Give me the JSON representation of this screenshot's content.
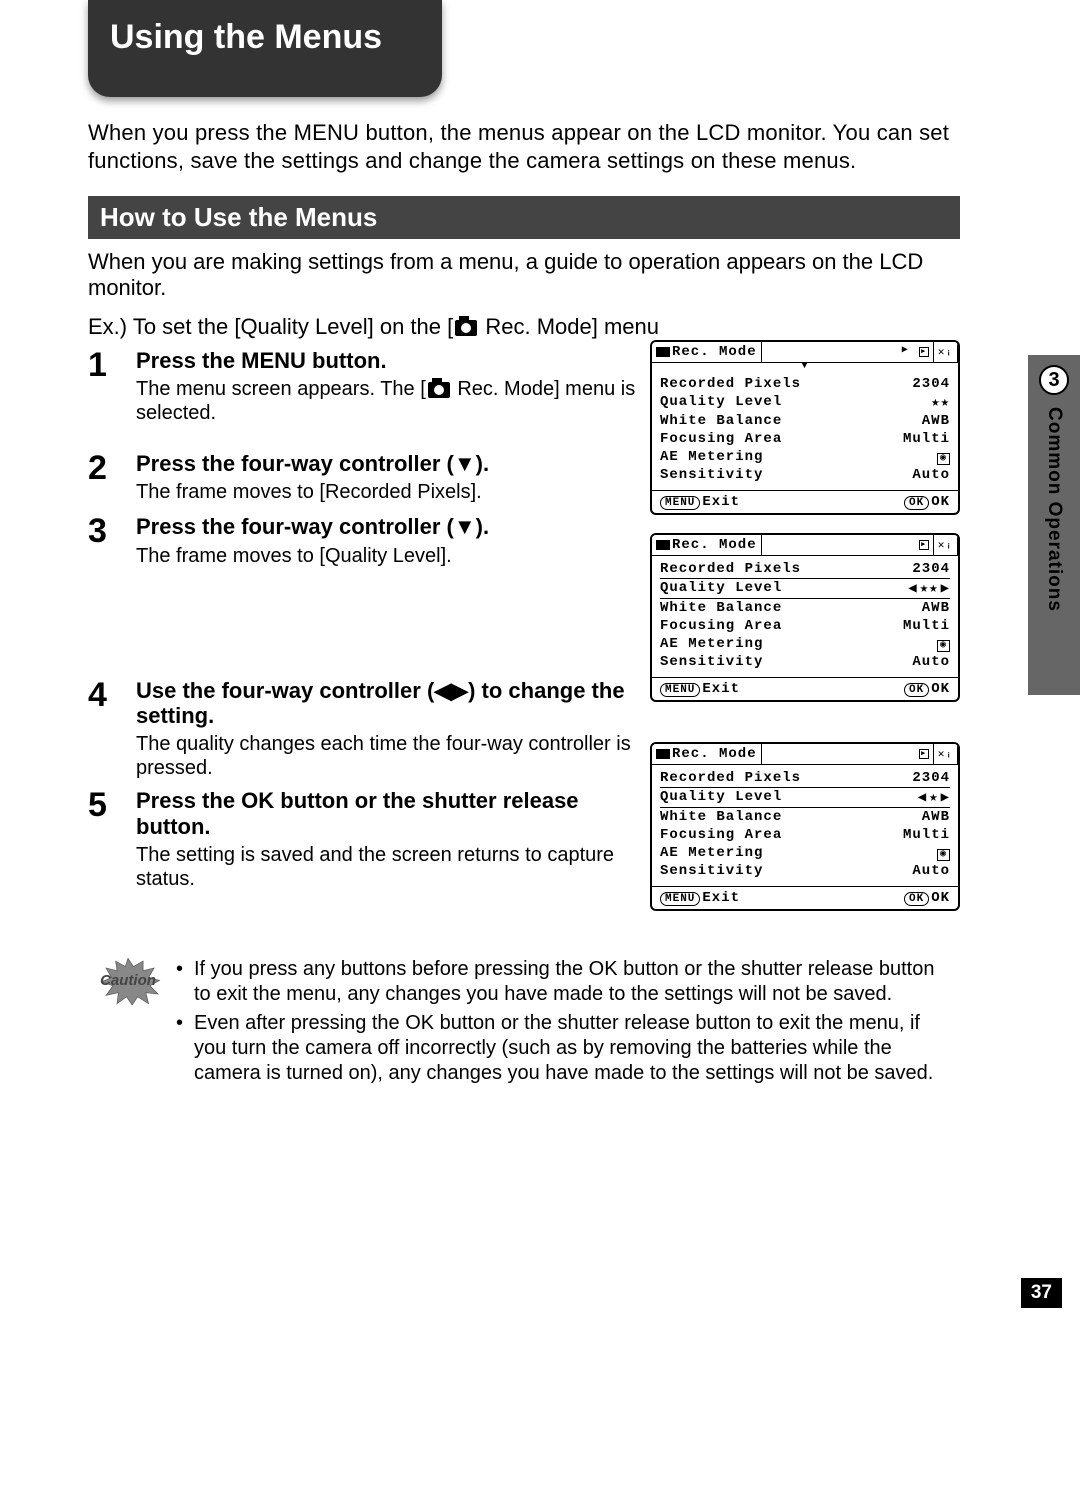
{
  "title": "Using the Menus",
  "chapter": {
    "number": "3",
    "name": "Common Operations"
  },
  "page_number": "37",
  "intro": "When you press the MENU button, the menus appear on the LCD monitor. You can set functions, save the settings and change the camera settings on these menus.",
  "section_heading": "How to Use the Menus",
  "sub_intro": "When you are making settings from a menu, a guide to operation appears on the LCD monitor.",
  "example_prefix": "Ex.) To set the [Quality Level] on the [",
  "example_suffix": " Rec. Mode] menu",
  "steps": [
    {
      "num": "1",
      "title": "Press the MENU button.",
      "desc_prefix": "The menu screen appears. The [",
      "desc_suffix": " Rec. Mode] menu is selected."
    },
    {
      "num": "2",
      "title": "Press the four-way controller (▼).",
      "desc": "The frame moves to [Recorded Pixels]."
    },
    {
      "num": "3",
      "title": "Press the four-way controller (▼).",
      "desc": "The frame moves to [Quality Level]."
    },
    {
      "num": "4",
      "title": "Use the four-way controller (◀▶) to change the setting.",
      "desc": "The quality changes each time the four-way controller is pressed."
    },
    {
      "num": "5",
      "title": "Press the OK button or the shutter release button.",
      "desc": "The setting is saved and the screen returns to capture status."
    }
  ],
  "menu": {
    "header_label": "Rec. Mode",
    "footer_left_chip": "MENU",
    "footer_left": "Exit",
    "footer_right_chip": "OK",
    "footer_right": "OK",
    "rows": {
      "recorded_pixels": {
        "label": "Recorded Pixels",
        "value": "2304"
      },
      "quality_level": {
        "label": "Quality Level"
      },
      "white_balance": {
        "label": "White Balance",
        "value": "AWB"
      },
      "focusing_area": {
        "label": "Focusing Area",
        "value": "Multi"
      },
      "ae_metering": {
        "label": "AE Metering"
      },
      "sensitivity": {
        "label": "Sensitivity",
        "value": "Auto"
      }
    },
    "quality_values": {
      "screen1": "★★",
      "screen2": "★★",
      "screen3": "★"
    }
  },
  "caution": {
    "label": "Caution",
    "items": [
      "If you press any buttons before pressing the OK button or the shutter release button to exit the menu, any changes you have made to the settings will not be saved.",
      "Even after pressing the OK button or the shutter release button to exit the menu, if you turn the camera off incorrectly (such as by removing the batteries while the camera is turned on), any changes you have made to the settings will not be saved."
    ]
  }
}
